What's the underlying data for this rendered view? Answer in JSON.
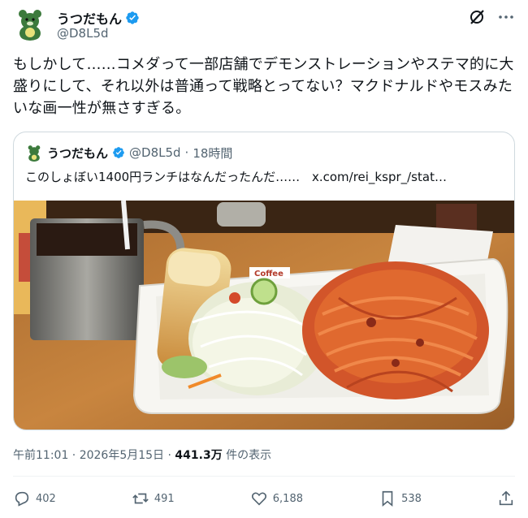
{
  "tweet": {
    "author_name": "うつだもん",
    "author_handle": "@D8L5d",
    "text": "もしかして……コメダって一部店舗でデモンストレーションやステマ的に大盛りにして、それ以外は普通って戦略とってない？マクドナルドやモスみたいな画一性が無さすぎる。",
    "timestamp": "午前11:01 · 2026年5月15日",
    "dot": "·",
    "views_count": "441.3万",
    "views_label": "件の表示"
  },
  "quote": {
    "author_name": "うつだもん",
    "author_handle": "@D8L5d",
    "sep": "·",
    "time": "18時間",
    "text": "このしょぼい1400円ランチはなんだったんだ……",
    "link": "x.com/rei_kspr_/stat…",
    "plate_logo": "Coffee"
  },
  "actions": {
    "reply_count": "402",
    "retweet_count": "491",
    "like_count": "6,188",
    "bookmark_count": "538"
  },
  "colors": {
    "verified": "#1d9bf0",
    "secondary_text": "#536471",
    "border": "#cfd9de"
  }
}
